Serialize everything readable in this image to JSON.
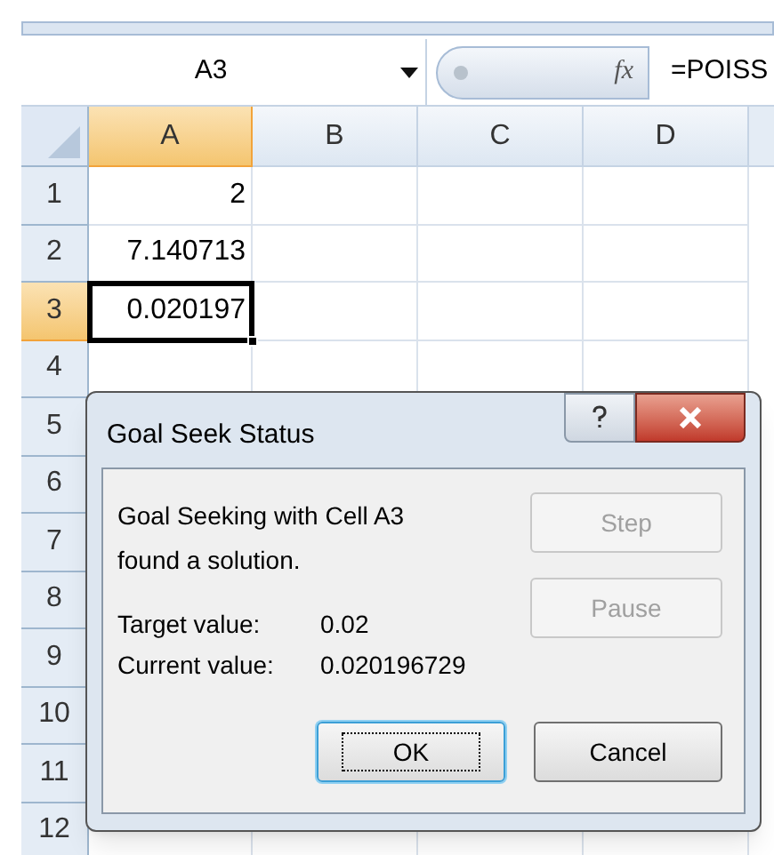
{
  "formula_bar": {
    "name_box": "A3",
    "formula": "=POISS",
    "fx": "fx"
  },
  "columns": [
    {
      "label": "A",
      "selected": true
    },
    {
      "label": "B",
      "selected": false
    },
    {
      "label": "C",
      "selected": false
    },
    {
      "label": "D",
      "selected": false
    }
  ],
  "rows": [
    {
      "label": "1",
      "selected": false,
      "cells": [
        {
          "text": "2",
          "active": false
        }
      ]
    },
    {
      "label": "2",
      "selected": false,
      "cells": [
        {
          "text": "7.140713",
          "active": false
        }
      ]
    },
    {
      "label": "3",
      "selected": true,
      "cells": [
        {
          "text": "0.020197",
          "active": true
        }
      ]
    },
    {
      "label": "4",
      "selected": false,
      "cells": []
    },
    {
      "label": "5",
      "selected": false,
      "cells": []
    },
    {
      "label": "6",
      "selected": false,
      "cells": []
    },
    {
      "label": "7",
      "selected": false,
      "cells": []
    },
    {
      "label": "8",
      "selected": false,
      "cells": []
    },
    {
      "label": "9",
      "selected": false,
      "cells": []
    },
    {
      "label": "10",
      "selected": false,
      "cells": []
    },
    {
      "label": "11",
      "selected": false,
      "cells": []
    },
    {
      "label": "12",
      "selected": false,
      "cells": []
    }
  ],
  "dialog": {
    "title": "Goal Seek Status",
    "message": "Goal Seeking with Cell A3 found a solution.",
    "fields": [
      {
        "label": "Target value:",
        "value": "0.02"
      },
      {
        "label": "Current value:",
        "value": "0.020196729"
      }
    ],
    "side_buttons": [
      {
        "label": "Step",
        "disabled": true
      },
      {
        "label": "Pause",
        "disabled": true
      }
    ],
    "buttons": [
      {
        "label": "OK",
        "default": true
      },
      {
        "label": "Cancel",
        "default": false
      }
    ]
  }
}
